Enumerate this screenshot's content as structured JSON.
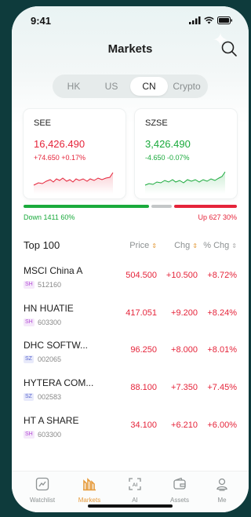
{
  "status": {
    "time": "9:41"
  },
  "header": {
    "title": "Markets"
  },
  "tabs": [
    {
      "label": "HK",
      "active": false
    },
    {
      "label": "US",
      "active": false
    },
    {
      "label": "CN",
      "active": true
    },
    {
      "label": "Crypto",
      "active": false
    }
  ],
  "indices": [
    {
      "name": "SEE",
      "value": "16,426.490",
      "change": "+74.650 +0.17%",
      "direction": "up",
      "color": "#e5243a"
    },
    {
      "name": "SZSE",
      "value": "3,426.490",
      "change": "-4.650 -0.07%",
      "direction": "down",
      "color": "#1aaa3c"
    }
  ],
  "breadth": {
    "down_label": "Down 1411 60%",
    "up_label": "Up 627 30%",
    "down_fraction": 0.6,
    "flat_fraction": 0.1,
    "up_fraction": 0.3,
    "down_color": "#1aaa3c",
    "flat_color": "#c4c7c8",
    "up_color": "#e5243a"
  },
  "table": {
    "title": "Top 100",
    "columns": {
      "price": "Price",
      "chg": "Chg",
      "pct": "% Chg"
    },
    "rows": [
      {
        "name": "MSCI China A",
        "market": "SH",
        "code": "512160",
        "price": "504.500",
        "chg": "+10.500",
        "pct": "+8.72%"
      },
      {
        "name": "HN HUATIE",
        "market": "SH",
        "code": "603300",
        "price": "417.051",
        "chg": "+9.200",
        "pct": "+8.24%"
      },
      {
        "name": "DHC SOFTW...",
        "market": "SZ",
        "code": "002065",
        "price": "96.250",
        "chg": "+8.000",
        "pct": "+8.01%"
      },
      {
        "name": "HYTERA COM...",
        "market": "SZ",
        "code": "002583",
        "price": "88.100",
        "chg": "+7.350",
        "pct": "+7.45%"
      },
      {
        "name": "HT A SHARE",
        "market": "SH",
        "code": "603300",
        "price": "34.100",
        "chg": "+6.210",
        "pct": "+6.00%"
      }
    ]
  },
  "tabbar": [
    {
      "label": "Watchlist",
      "icon": "chart-icon",
      "active": false
    },
    {
      "label": "Markets",
      "icon": "markets-icon",
      "active": true
    },
    {
      "label": "AI",
      "icon": "ai-icon",
      "active": false
    },
    {
      "label": "Assets",
      "icon": "wallet-icon",
      "active": false
    },
    {
      "label": "Me",
      "icon": "profile-icon",
      "active": false
    }
  ]
}
